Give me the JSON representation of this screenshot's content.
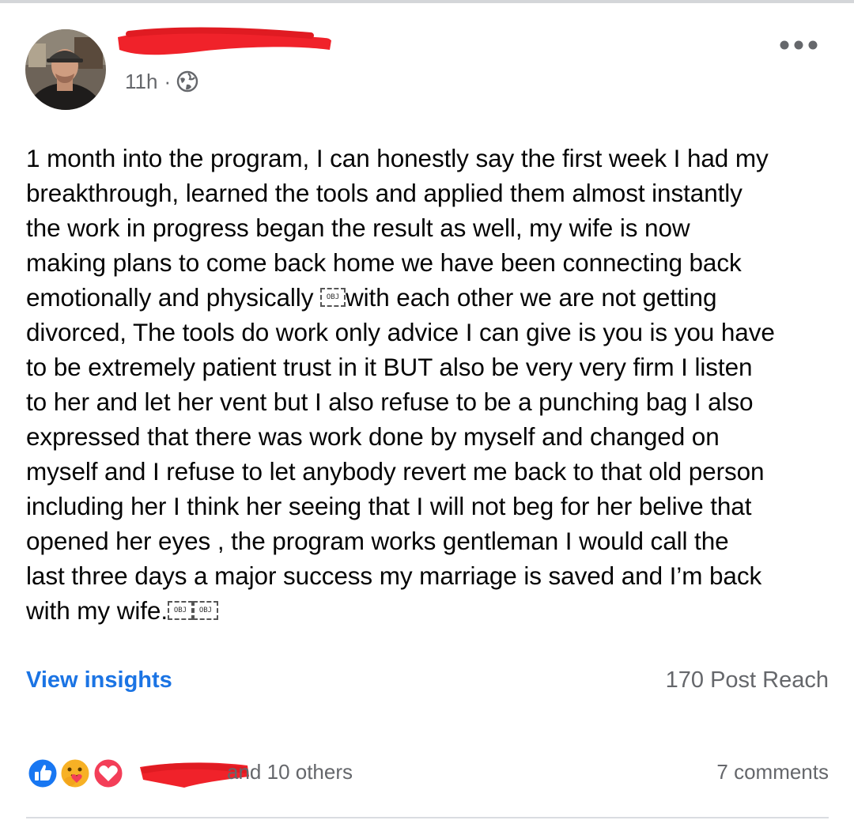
{
  "post": {
    "time": "11h",
    "separator": "·",
    "privacy_icon": "globe-icon",
    "more_icon": "more-options-icon",
    "body_lines": [
      "1 month into the program, I can honestly say the first week I had my",
      "breakthrough, learned the tools and applied them almost instantly",
      "the work in progress began the result as well, my wife is now",
      "making plans to come back home we have been connecting back",
      {
        "before": "emotionally and physically ",
        "obj": "OBJ",
        "after": "with each other we are not getting"
      },
      "divorced, The tools do work only advice I can give is you is you have",
      "to be extremely patient trust in it BUT also be very very firm I listen",
      "to her and let her vent but I also refuse to be a punching bag I also",
      "expressed that there was work done by myself and changed on",
      "myself and I refuse to let anybody revert me back to that old person",
      "including her I think her seeing that I will not beg for her belive that",
      "opened her eyes , the program works gentleman I would call the",
      "last three days a major success my marriage is saved and I’m back",
      {
        "before": "with my wife.",
        "obj": "OBJ",
        "obj2": "OBJ",
        "after": ""
      }
    ]
  },
  "insights": {
    "link": "View insights",
    "reach": "170 Post Reach"
  },
  "reactions": {
    "icons": [
      "like-icon",
      "care-icon",
      "love-icon"
    ],
    "others_text": "and 10 others",
    "comments": "7 comments"
  },
  "colors": {
    "link_blue": "#1b74e4",
    "secondary_text": "#65676b",
    "body_text": "#050505",
    "redaction_red": "#f0222a",
    "like_blue": "#1877f2",
    "love_red": "#f33e58",
    "care_yellow": "#f7b125"
  }
}
